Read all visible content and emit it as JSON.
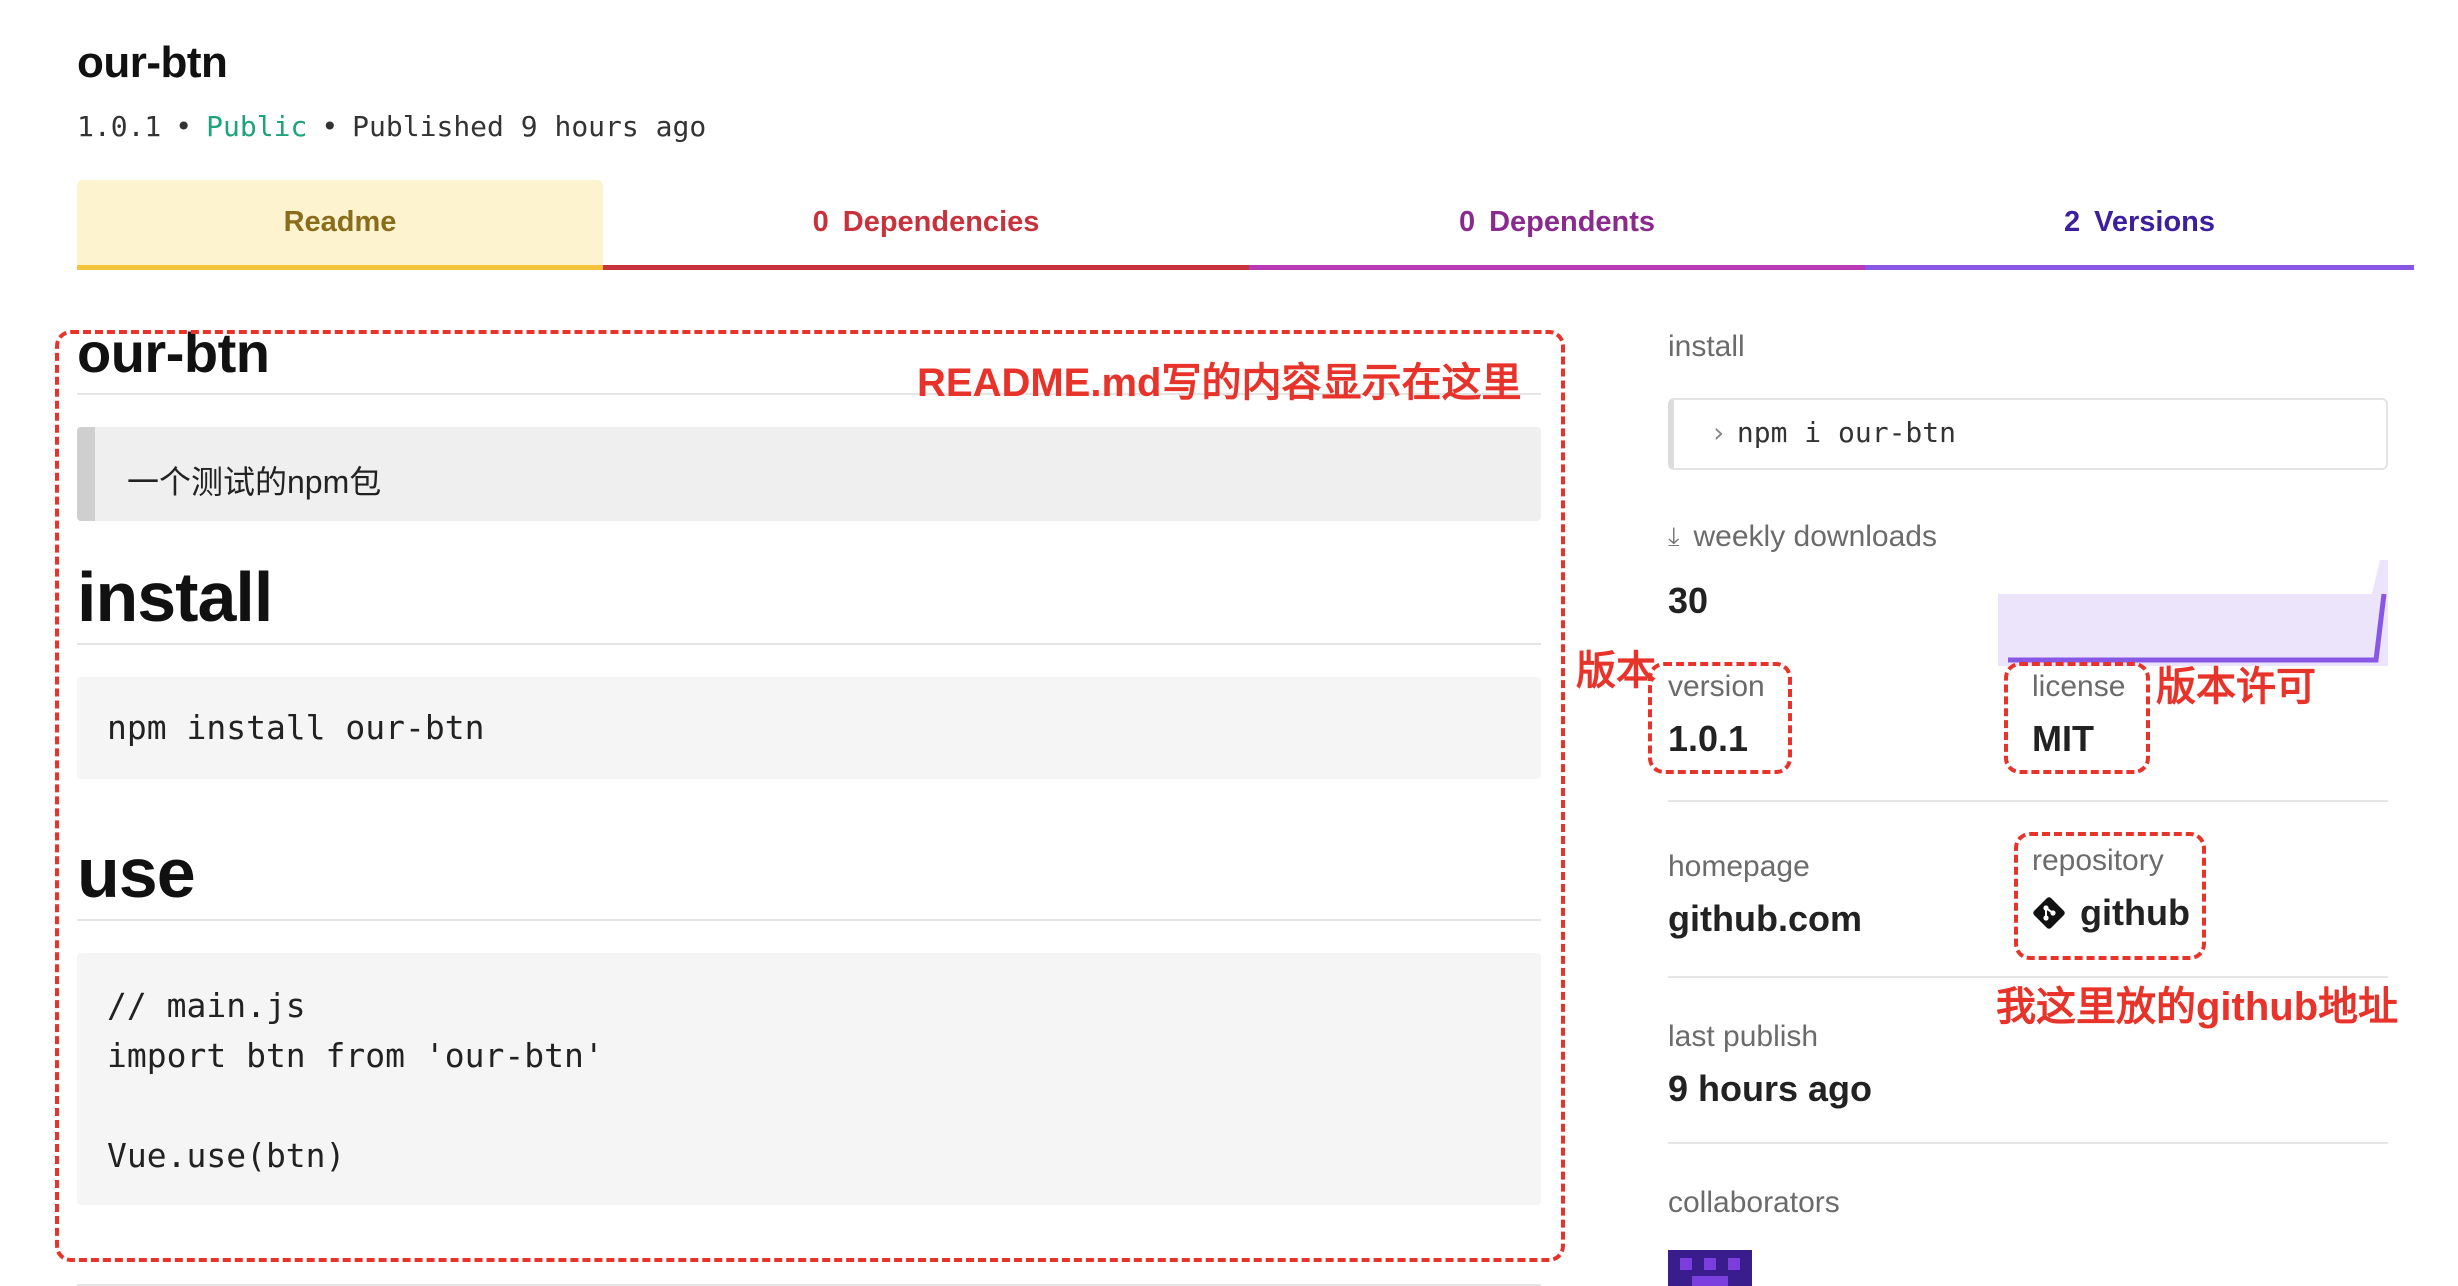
{
  "package": {
    "name": "our-btn",
    "version": "1.0.1",
    "visibility": "Public",
    "published": "Published 9 hours ago",
    "separator": "•"
  },
  "tabs": {
    "readme": "Readme",
    "dependencies": {
      "count": "0",
      "label": "Dependencies"
    },
    "dependents": {
      "count": "0",
      "label": "Dependents"
    },
    "versions": {
      "count": "2",
      "label": "Versions"
    }
  },
  "readme": {
    "title": "our-btn",
    "quote": "一个测试的npm包",
    "install_heading": "install",
    "install_code": "npm install our-btn",
    "use_heading": "use",
    "use_code": "// main.js\nimport btn from 'our-btn'\n\nVue.use(btn)"
  },
  "sidebar": {
    "install_label": "install",
    "install_command": "npm i our-btn",
    "weekly_downloads_label": "weekly downloads",
    "weekly_downloads_value": "30",
    "version_label": "version",
    "version_value": "1.0.1",
    "license_label": "license",
    "license_value": "MIT",
    "homepage_label": "homepage",
    "homepage_value": "github.com",
    "repository_label": "repository",
    "repository_value": "github",
    "last_publish_label": "last publish",
    "last_publish_value": "9 hours ago",
    "collaborators_label": "collaborators"
  },
  "annotations": {
    "readme_note": "README.md写的内容显示在这里",
    "version_note": "版本",
    "license_note": "版本许可",
    "repo_note": "我这里放的github地址"
  },
  "colors": {
    "public": "#1fa37a",
    "annotation": "#e8332b",
    "readme_tab": "#f5c33b",
    "dependencies_tab": "#c8323d",
    "dependents_tab": "#b73ab4",
    "versions_tab": "#8957e5"
  },
  "icons": {
    "download": "download-icon",
    "git": "git-icon",
    "prompt": "chevron-right-icon"
  }
}
